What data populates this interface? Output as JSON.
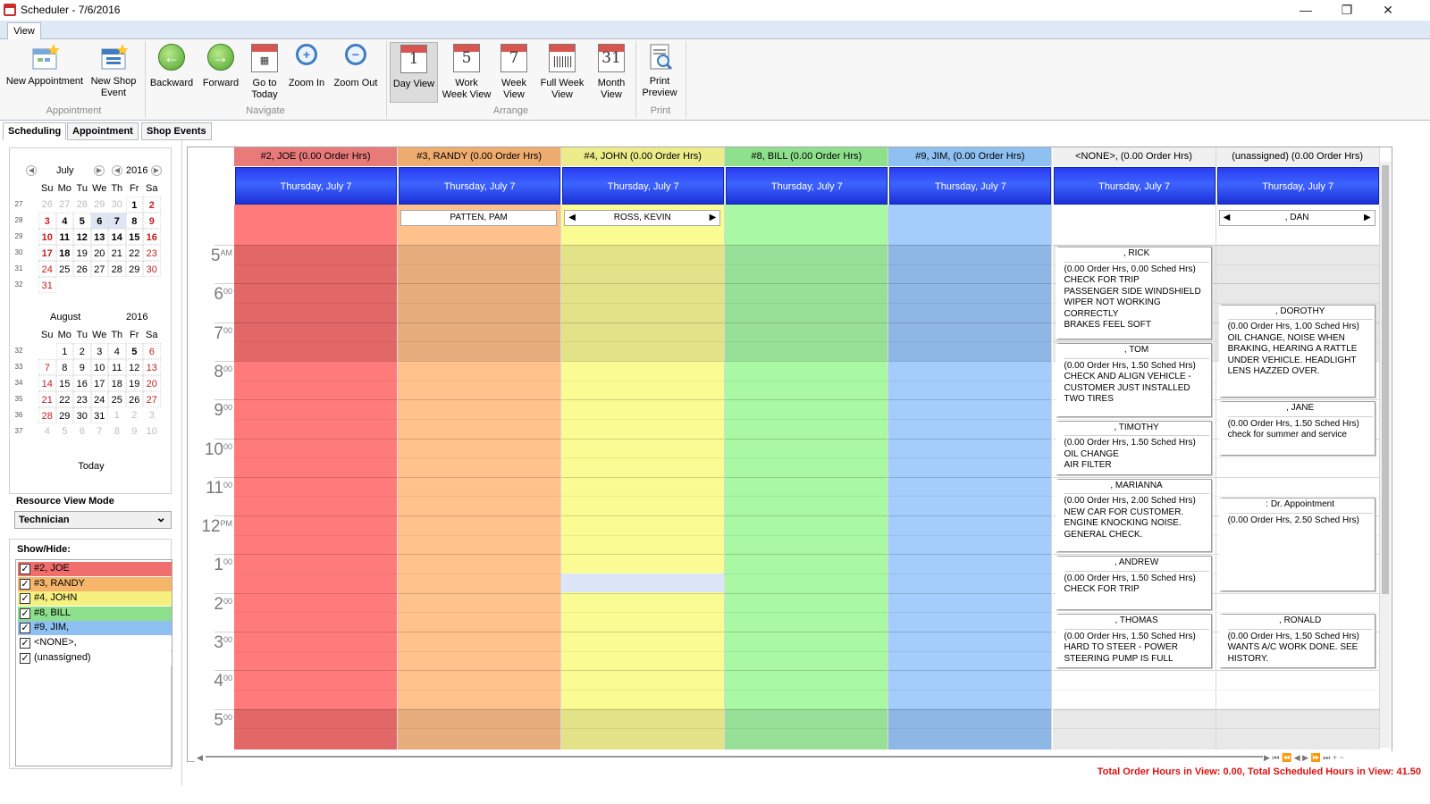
{
  "window": {
    "title": "Scheduler - 7/6/2016"
  },
  "ribbon": {
    "tab": "View",
    "buttons": {
      "new_appointment": "New Appointment",
      "new_shop_event": "New Shop Event",
      "backward": "Backward",
      "forward": "Forward",
      "go_to_today": "Go to Today",
      "zoom_in": "Zoom In",
      "zoom_out": "Zoom Out",
      "day_view": "Day View",
      "work_week_view": "Work Week View",
      "week_view": "Week View",
      "full_week_view": "Full Week View",
      "month_view": "Month View",
      "print_preview": "Print Preview"
    },
    "calendar_numbers": {
      "day": "1",
      "work_week": "5",
      "week": "7",
      "month": "31"
    },
    "groups": {
      "appointment": "Appointment",
      "navigate": "Navigate",
      "arrange": "Arrange",
      "print": "Print"
    }
  },
  "tabs": [
    "Scheduling",
    "Appointment",
    "Shop Events"
  ],
  "calendar": {
    "july": {
      "name": "July",
      "year": "2016",
      "dow": [
        "Su",
        "Mo",
        "Tu",
        "We",
        "Th",
        "Fr",
        "Sa"
      ],
      "weeks": [
        "27",
        "28",
        "29",
        "30",
        "31",
        "32"
      ],
      "rows": [
        [
          "26",
          "27",
          "28",
          "29",
          "30",
          "1",
          "2"
        ],
        [
          "3",
          "4",
          "5",
          "6",
          "7",
          "8",
          "9"
        ],
        [
          "10",
          "11",
          "12",
          "13",
          "14",
          "15",
          "16"
        ],
        [
          "17",
          "18",
          "19",
          "20",
          "21",
          "22",
          "23"
        ],
        [
          "24",
          "25",
          "26",
          "27",
          "28",
          "29",
          "30"
        ],
        [
          "31",
          "",
          "",
          "",
          "",
          "",
          ""
        ]
      ]
    },
    "august": {
      "name": "August",
      "year": "2016",
      "dow": [
        "Su",
        "Mo",
        "Tu",
        "We",
        "Th",
        "Fr",
        "Sa"
      ],
      "weeks": [
        "32",
        "33",
        "34",
        "35",
        "36",
        "37"
      ],
      "rows": [
        [
          "",
          "1",
          "2",
          "3",
          "4",
          "5",
          "6"
        ],
        [
          "7",
          "8",
          "9",
          "10",
          "11",
          "12",
          "13"
        ],
        [
          "14",
          "15",
          "16",
          "17",
          "18",
          "19",
          "20"
        ],
        [
          "21",
          "22",
          "23",
          "24",
          "25",
          "26",
          "27"
        ],
        [
          "28",
          "29",
          "30",
          "31",
          "1",
          "2",
          "3"
        ],
        [
          "4",
          "5",
          "6",
          "7",
          "8",
          "9",
          "10"
        ]
      ]
    },
    "today_label": "Today"
  },
  "resource_view": {
    "label": "Resource View Mode",
    "value": "Technician"
  },
  "show_hide": {
    "label": "Show/Hide:",
    "items": [
      {
        "label": "#2, JOE",
        "color": "#f06e6e"
      },
      {
        "label": "#3, RANDY",
        "color": "#f5b56a"
      },
      {
        "label": "#4, JOHN",
        "color": "#f5f07f"
      },
      {
        "label": "#8, BILL",
        "color": "#8ee08c"
      },
      {
        "label": "#9, JIM,",
        "color": "#8ec0f2"
      },
      {
        "label": "<NONE>,",
        "color": "#ffffff"
      },
      {
        "label": "(unassigned)",
        "color": "#ffffff"
      }
    ]
  },
  "hours": [
    "5",
    "6",
    "7",
    "8",
    "9",
    "10",
    "11",
    "12",
    "1",
    "2",
    "3",
    "4",
    "5"
  ],
  "hour_suffix": [
    "AM",
    "00",
    "00",
    "00",
    "00",
    "00",
    "00",
    "PM",
    "00",
    "00",
    "00",
    "00",
    "00"
  ],
  "columns": [
    {
      "header": "#2, JOE (0.00 Order Hrs)",
      "date": "Thursday, July 7",
      "head_color": "#e87a7a",
      "dark": "#e26767",
      "light": "#ff7b7b"
    },
    {
      "header": "#3, RANDY (0.00 Order Hrs)",
      "date": "Thursday, July 7",
      "head_color": "#efac6f",
      "dark": "#e7ad7d",
      "light": "#ffc28c"
    },
    {
      "header": "#4, JOHN (0.00 Order Hrs)",
      "date": "Thursday, July 7",
      "head_color": "#ecec8a",
      "dark": "#e2e288",
      "light": "#fbfb93"
    },
    {
      "header": "#8, BILL (0.00 Order Hrs)",
      "date": "Thursday, July 7",
      "head_color": "#8ee08c",
      "dark": "#98e098",
      "light": "#a8f8a4"
    },
    {
      "header": "#9, JIM,  (0.00 Order Hrs)",
      "date": "Thursday, July 7",
      "head_color": "#8ec0f2",
      "dark": "#8fb7e5",
      "light": "#a4cdfb"
    },
    {
      "header": "<NONE>,  (0.00 Order Hrs)",
      "date": "Thursday, July 7",
      "head_color": "#f0f0f0",
      "dark": "#e8e8e8",
      "light": "#ffffff"
    },
    {
      "header": "(unassigned) (0.00 Order Hrs)",
      "date": "Thursday, July 7",
      "head_color": "#f0f0f0",
      "dark": "#e8e8e8",
      "light": "#ffffff"
    }
  ],
  "allday": [
    {
      "col": 1,
      "label": "PATTEN, PAM",
      "arrows": false
    },
    {
      "col": 2,
      "label": "ROSS, KEVIN",
      "arrows": true
    },
    {
      "col": 6,
      "label": ", DAN",
      "arrows": true
    }
  ],
  "appointments_none": [
    {
      "name": ", RICK",
      "detail": [
        "(0.00 Order Hrs, 0.00 Sched Hrs)",
        "CHECK FOR TRIP",
        "PASSENGER SIDE WINDSHIELD",
        "WIPER NOT WORKING",
        "CORRECTLY",
        "BRAKES FEEL SOFT"
      ]
    },
    {
      "name": ", TOM",
      "detail": [
        "(0.00 Order Hrs, 1.50 Sched Hrs)",
        "CHECK AND ALIGN VEHICLE -",
        "CUSTOMER JUST INSTALLED",
        "TWO TIRES"
      ]
    },
    {
      "name": ", TIMOTHY",
      "detail": [
        "(0.00 Order Hrs, 1.50 Sched Hrs)",
        "OIL CHANGE",
        "AIR FILTER"
      ]
    },
    {
      "name": ", MARIANNA",
      "detail": [
        "(0.00 Order Hrs, 2.00 Sched Hrs)",
        "NEW CAR FOR CUSTOMER.",
        "ENGINE KNOCKING NOISE.",
        "GENERAL CHECK."
      ]
    },
    {
      "name": ", ANDREW",
      "detail": [
        "(0.00 Order Hrs, 1.50 Sched Hrs)",
        "CHECK FOR TRIP"
      ]
    },
    {
      "name": ", THOMAS",
      "detail": [
        "(0.00 Order Hrs, 1.50 Sched Hrs)",
        "HARD TO STEER - POWER",
        "STEERING PUMP IS FULL"
      ]
    }
  ],
  "appointments_unassigned": [
    {
      "name": ", DOROTHY",
      "detail": [
        "(0.00 Order Hrs, 1.00 Sched Hrs)",
        "OIL CHANGE, NOISE WHEN",
        "BRAKING, HEARING A RATTLE",
        "UNDER VEHICLE. HEADLIGHT",
        "LENS HAZZED OVER."
      ]
    },
    {
      "name": ", JANE",
      "detail": [
        "(0.00 Order Hrs, 1.50 Sched Hrs)",
        "check for summer and service"
      ]
    },
    {
      "name": ": Dr. Appointment",
      "detail": [
        "(0.00 Order Hrs, 2.50 Sched Hrs)"
      ]
    },
    {
      "name": ", RONALD",
      "detail": [
        "(0.00 Order Hrs, 1.50 Sched Hrs)",
        "WANTS A/C WORK DONE. SEE",
        "HISTORY."
      ]
    }
  ],
  "footer": {
    "total": "Total Order Hours in View: 0.00, Total Scheduled Hours in View: 41.50"
  }
}
